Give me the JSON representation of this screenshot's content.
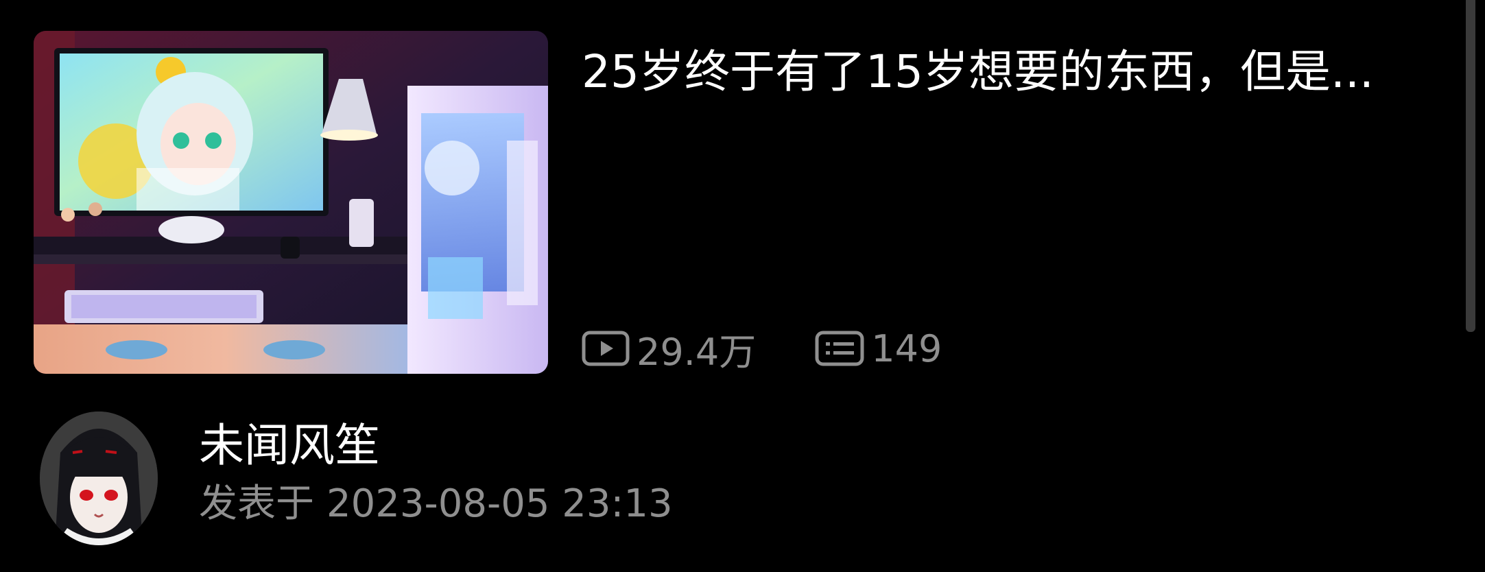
{
  "video": {
    "title": "25岁终于有了15岁想要的东西，但是...",
    "stats": {
      "plays": "29.4万",
      "comments": "149"
    },
    "icons": {
      "plays": "play-icon",
      "comments": "comment-icon"
    }
  },
  "author": {
    "name": "未闻风笙",
    "publish_label": "发表于",
    "publish_time": "2023-08-05 23:13"
  },
  "colors": {
    "background": "#000000",
    "primary_text": "#ffffff",
    "secondary_text": "#8f8f8f",
    "scrollbar": "#3a3a3a"
  }
}
